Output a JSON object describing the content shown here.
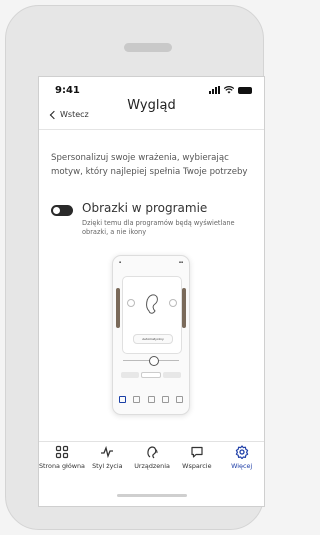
{
  "status": {
    "time": "9:41"
  },
  "header": {
    "back_label": "Wstecz",
    "title": "Wygląd"
  },
  "intro": "Spersonalizuj swoje wrażenia, wybierając motyw, który najlepiej spełnia Twoje potrzeby",
  "setting": {
    "label": "Obrazki w programie",
    "description": "Dzięki temu dla programów będą wyświetlane obrazki, a nie ikony",
    "enabled": false
  },
  "preview": {
    "chip_label": "Automatyczny"
  },
  "tabs": [
    {
      "label": "Strona główna",
      "icon": "grid-icon"
    },
    {
      "label": "Styl życia",
      "icon": "pulse-icon"
    },
    {
      "label": "Urządzenia",
      "icon": "hearing-aid-icon"
    },
    {
      "label": "Wsparcie",
      "icon": "chat-bubble-icon"
    },
    {
      "label": "Więcej",
      "icon": "gear-icon",
      "active": true
    }
  ],
  "colors": {
    "accent": "#2140a8",
    "toggle_off": "#2a2a2a"
  }
}
